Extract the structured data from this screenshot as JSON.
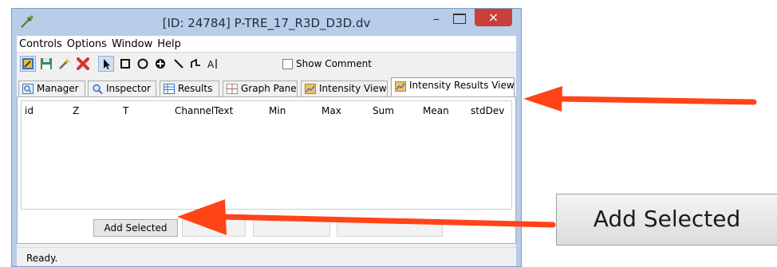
{
  "window": {
    "title": "[ID: 24784] P-TRE_17_R3D_D3D.dv",
    "minimize_glyph": "–",
    "close_glyph": "×"
  },
  "menu": [
    "Controls",
    "Options",
    "Window",
    "Help"
  ],
  "toolbar": {
    "show_comment_label": "Show Comment",
    "show_comment_checked": false
  },
  "tabs": [
    {
      "label": "Manager",
      "icon": "manager-icon"
    },
    {
      "label": "Inspector",
      "icon": "magnifier-icon"
    },
    {
      "label": "Results",
      "icon": "table-icon"
    },
    {
      "label": "Graph Pane",
      "icon": "graph-icon"
    },
    {
      "label": "Intensity View",
      "icon": "intensity-icon"
    },
    {
      "label": "Intensity Results View",
      "icon": "intensity-results-icon",
      "active": true
    }
  ],
  "table": {
    "columns": [
      "id",
      "Z",
      "T",
      "Channel",
      "Text",
      "Min",
      "Max",
      "Sum",
      "Mean",
      "stdDev"
    ],
    "rows": []
  },
  "buttons": {
    "add_selected": "Add Selected"
  },
  "status": "Ready.",
  "callout": {
    "label": "Add Selected"
  },
  "colors": {
    "arrow": "#ff4418",
    "close_button": "#c9403a",
    "window_frame": "#b7cde8"
  }
}
